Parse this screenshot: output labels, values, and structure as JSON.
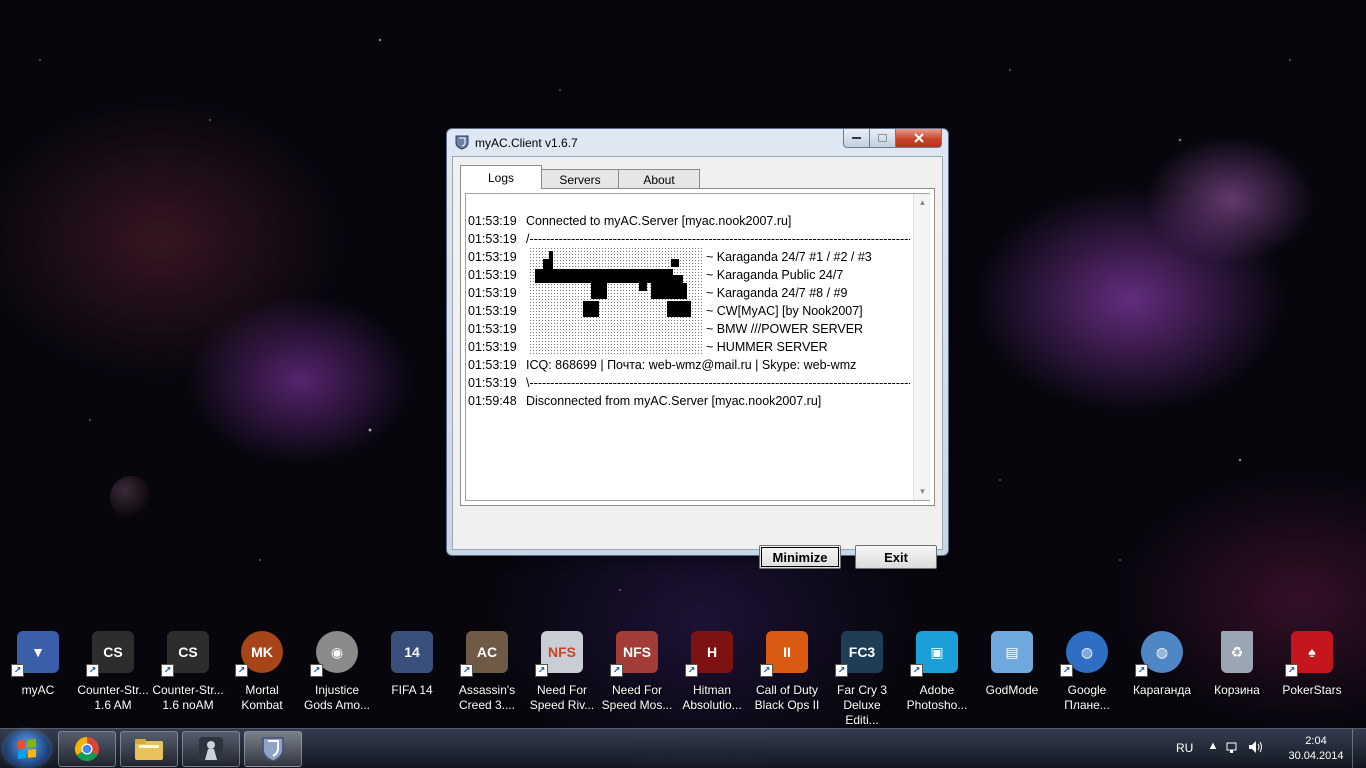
{
  "window": {
    "title": "myAC.Client  v1.6.7",
    "tabs": [
      {
        "label": "Logs",
        "active": true
      },
      {
        "label": "Servers",
        "active": false
      },
      {
        "label": "About",
        "active": false
      }
    ],
    "log": [
      {
        "time": "01:53:19",
        "text": "Connected to myAC.Server [myac.nook2007.ru]"
      },
      {
        "time": "01:53:19",
        "text": "/-------------------------------------------------------------------------------------------------\\"
      },
      {
        "time": "01:53:19",
        "text": "~ Karaganda 24/7 #1 / #2 / #3",
        "art": true
      },
      {
        "time": "01:53:19",
        "text": "~ Karaganda Public 24/7",
        "art": true
      },
      {
        "time": "01:53:19",
        "text": "~ Karaganda 24/7 #8 / #9",
        "art": true
      },
      {
        "time": "01:53:19",
        "text": "~ CW[MyAC] [by Nook2007]",
        "art": true
      },
      {
        "time": "01:53:19",
        "text": "~ BMW ///POWER SERVER",
        "art": true
      },
      {
        "time": "01:53:19",
        "text": "~ HUMMER SERVER",
        "art": true
      },
      {
        "time": "01:53:19",
        "text": "ICQ: 868699 | Почта: web-wmz@mail.ru | Skype: web-wmz"
      },
      {
        "time": "01:53:19",
        "text": "\\-------------------------------------------------------------------------------------------------/"
      },
      {
        "time": "01:59:48",
        "text": "Disconnected from myAC.Server [myac.nook2007.ru]"
      }
    ],
    "buttons": {
      "minimize": "Minimize",
      "exit": "Exit"
    }
  },
  "desktop_icons": [
    {
      "label": "myAC",
      "icon": "shield-icon",
      "color": "#3b5ea8"
    },
    {
      "label": "Counter-Str...\n1.6 AM",
      "icon": "cs-icon",
      "color": "#2d2d2d"
    },
    {
      "label": "Counter-Str...\n1.6 noAM",
      "icon": "cs-icon",
      "color": "#2d2d2d"
    },
    {
      "label": "Mortal\nKombat",
      "icon": "dragon-icon",
      "color": "#a8441a"
    },
    {
      "label": "Injustice\nGods Amo...",
      "icon": "disc-icon",
      "color": "#8a8a8a"
    },
    {
      "label": "FIFA 14",
      "icon": "fifa-icon",
      "color": "#3a4f7a"
    },
    {
      "label": "Assassin's\nCreed 3....",
      "icon": "assassin-icon",
      "color": "#6e5a45"
    },
    {
      "label": "Need For\nSpeed Riv...",
      "icon": "nfs-icon",
      "color": "#c9ced6"
    },
    {
      "label": "Need For\nSpeed Mos...",
      "icon": "nfs-icon",
      "color": "#a33b36"
    },
    {
      "label": "Hitman\nAbsolutio...",
      "icon": "hitman-icon",
      "color": "#7e1111"
    },
    {
      "label": "Call of Duty\nBlack Ops II",
      "icon": "cod-icon",
      "color": "#d95a10"
    },
    {
      "label": "Far Cry 3\nDeluxe Editi...",
      "icon": "fc3-icon",
      "color": "#1d3e55"
    },
    {
      "label": "Adobe\nPhotosho...",
      "icon": "photoshop-icon",
      "color": "#1a9fd8"
    },
    {
      "label": "GodMode",
      "icon": "control-panel-icon",
      "color": "#6fa8dc"
    },
    {
      "label": "Google\nПлане...",
      "icon": "google-earth-icon",
      "color": "#2e6fc4"
    },
    {
      "label": "Караганда",
      "icon": "globe-icon",
      "color": "#4f86c6"
    },
    {
      "label": "Корзина",
      "icon": "recycle-bin-icon",
      "color": "#9aa6b2"
    },
    {
      "label": "PokerStars",
      "icon": "pokerstars-icon",
      "color": "#c4161c"
    }
  ],
  "taskbar": {
    "items": [
      {
        "name": "chrome",
        "icon": "chrome-icon"
      },
      {
        "name": "explorer",
        "icon": "folder-icon"
      },
      {
        "name": "counter-strike",
        "icon": "cs-icon"
      },
      {
        "name": "myac",
        "icon": "shield-icon",
        "active": true
      }
    ],
    "lang": "RU",
    "time": "2:04",
    "date": "30.04.2014"
  }
}
